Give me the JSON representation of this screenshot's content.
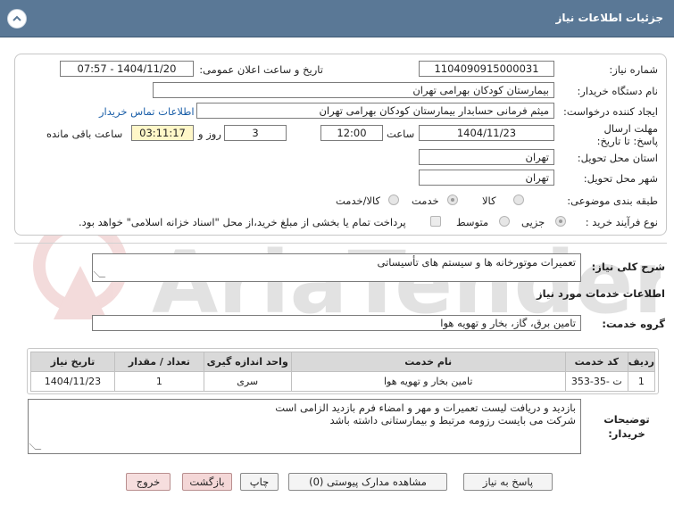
{
  "header": {
    "title": "جزئیات اطلاعات نیاز"
  },
  "fields": {
    "need_number_label": "شماره نیاز:",
    "need_number": "1104090915000031",
    "announce_label": "تاریخ و ساعت اعلان عمومی:",
    "announce_value": "1404/11/20 - 07:57",
    "buyer_label": "نام دستگاه خریدار:",
    "buyer": "بیمارستان کودکان بهرامی تهران",
    "creator_label": "ایجاد کننده درخواست:",
    "creator": "میثم  فرمانی حسابدار بیمارستان کودکان بهرامی تهران",
    "contact_link": "اطلاعات تماس خریدار",
    "deadline_label": "مهلت ارسال پاسخ: تا تاریخ:",
    "deadline_date": "1404/11/23",
    "time_label": "ساعت",
    "deadline_time": "12:00",
    "days_value": "3",
    "days_label": "روز و",
    "remaining_time": "03:11:17",
    "remaining_label": "ساعت باقی مانده",
    "province_label": "استان محل تحویل:",
    "province": "تهران",
    "city_label": "شهر محل تحویل:",
    "city": "تهران",
    "category_label": "طبقه بندی موضوعی:",
    "category_options": [
      "کالا",
      "خدمت",
      "کالا/خدمت"
    ],
    "process_label": "نوع فرآیند خرید :",
    "process_options": [
      "جزیی",
      "متوسط"
    ],
    "payment_note": "پرداخت تمام یا بخشی از مبلغ خرید،از محل \"اسناد خزانه اسلامی\" خواهد بود."
  },
  "description": {
    "label": "شرح کلی نیاز:",
    "value": "تعمیرات موتورخانه ها و سیستم های تأسیساتی"
  },
  "services": {
    "section_title": "اطلاعات خدمات مورد نیاز",
    "group_label": "گروه خدمت:",
    "group_value": "تامین برق، گاز، بخار و تهویه هوا",
    "columns": [
      "ردیف",
      "کد خدمت",
      "نام خدمت",
      "واحد اندازه گیری",
      "تعداد / مقدار",
      "تاریخ نیاز"
    ],
    "rows": [
      {
        "row": "1",
        "code": "ت -35-353",
        "name": "تامین بخار و تهویه هوا",
        "unit": "سری",
        "qty": "1",
        "date": "1404/11/23"
      }
    ]
  },
  "buyer_notes": {
    "label": "توضیحات خریدار:",
    "line1": "بازدید و دریافت لیست تعمیرات و مهر و امضاء فرم بازدید الزامی است",
    "line2": "شرکت می بایست رزومه مرتبط و بیمارستانی داشته باشد"
  },
  "buttons": {
    "reply": "پاسخ به نیاز",
    "view_docs": "مشاهده مدارک پیوستی (0)",
    "print": "چاپ",
    "back": "بازگشت",
    "exit": "خروج"
  },
  "watermark": "AriaTender.neT",
  "colors": {
    "header": "#5a7896",
    "link": "#1a5ea8",
    "timer_bg": "#fff7c8"
  }
}
